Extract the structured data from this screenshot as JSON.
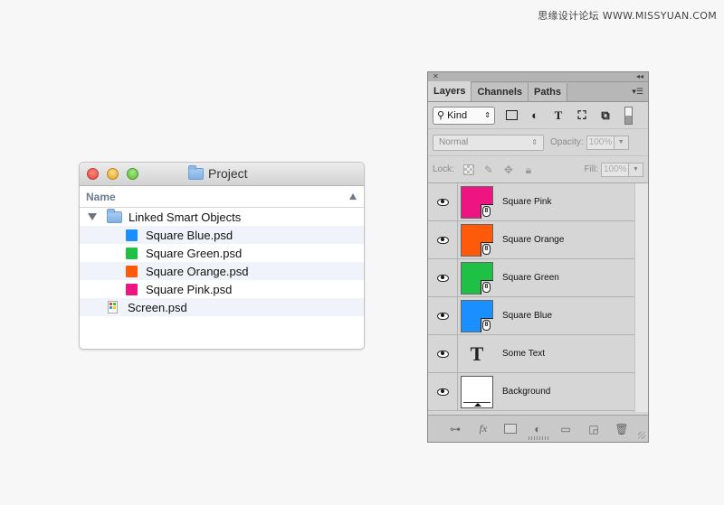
{
  "watermark": "思缘设计论坛 WWW.MISSYUAN.COM",
  "finder": {
    "title": "Project",
    "column_header": "Name",
    "items": [
      {
        "label": "Linked Smart Objects",
        "type": "folder",
        "expanded": true
      },
      {
        "label": "Square Blue.psd",
        "swatch": "#1a8fff"
      },
      {
        "label": "Square Green.psd",
        "swatch": "#1ec046"
      },
      {
        "label": "Square Orange.psd",
        "swatch": "#ff5a0a"
      },
      {
        "label": "Square Pink.psd",
        "swatch": "#ee1481"
      },
      {
        "label": "Screen.psd",
        "type": "psd"
      }
    ]
  },
  "layers_panel": {
    "tabs": [
      "Layers",
      "Channels",
      "Paths"
    ],
    "active_tab": "Layers",
    "filter": {
      "kind_label": "Kind"
    },
    "blend_mode": "Normal",
    "opacity": {
      "label": "Opacity:",
      "value": "100%"
    },
    "lock_label": "Lock:",
    "fill": {
      "label": "Fill:",
      "value": "100%"
    },
    "layers": [
      {
        "name": "Square Pink",
        "color": "#ee1481",
        "kind": "smart"
      },
      {
        "name": "Square Orange",
        "color": "#ff5a0a",
        "kind": "smart"
      },
      {
        "name": "Square Green",
        "color": "#1ec046",
        "kind": "smart"
      },
      {
        "name": "Square Blue",
        "color": "#1a8fff",
        "kind": "smart"
      },
      {
        "name": "Some Text",
        "kind": "text"
      },
      {
        "name": "Background",
        "kind": "background"
      }
    ],
    "bottom_icons": [
      "link-icon",
      "fx-icon",
      "mask-icon",
      "adjustment-icon",
      "group-folder-icon",
      "new-layer-icon",
      "trash-icon"
    ]
  }
}
